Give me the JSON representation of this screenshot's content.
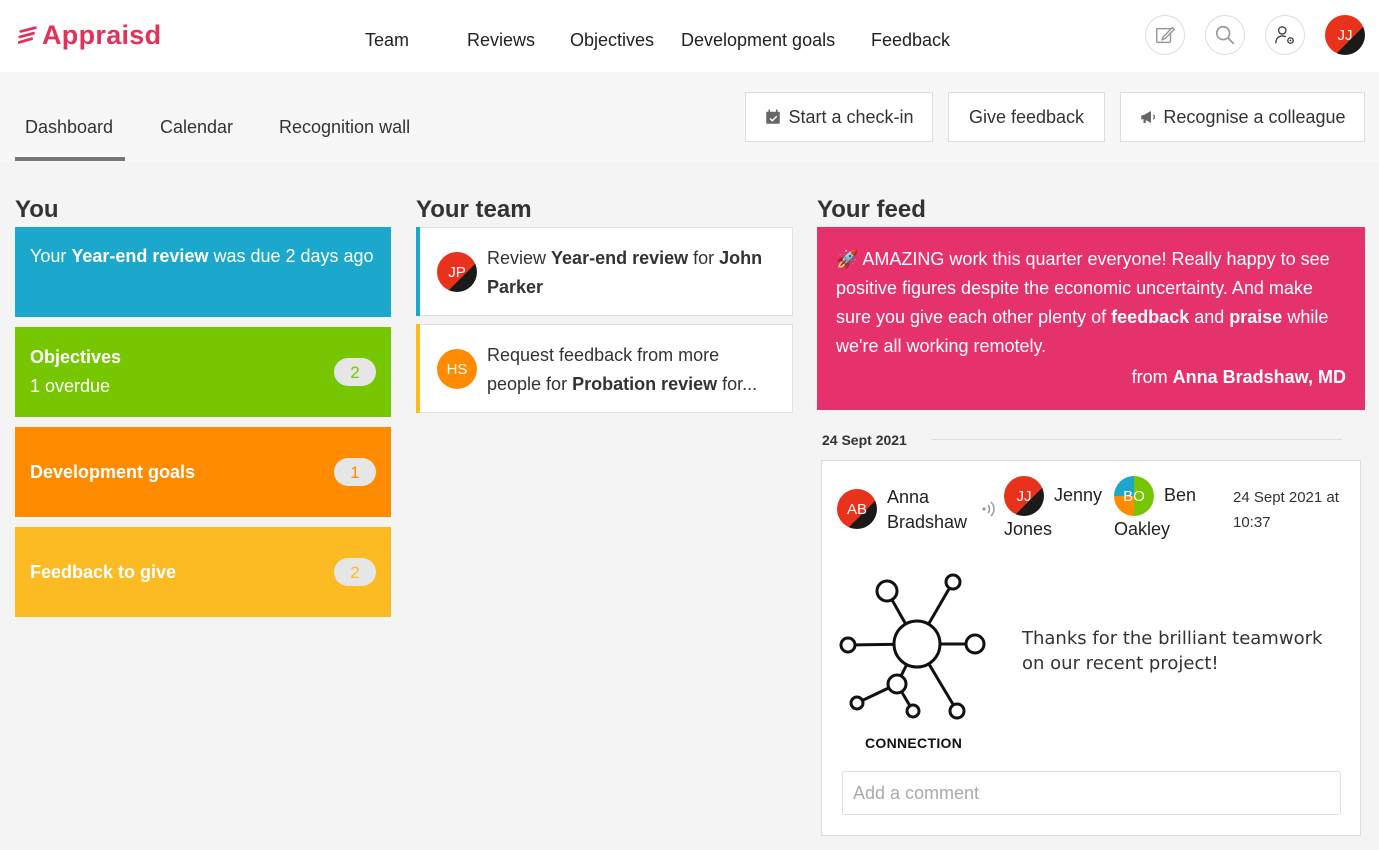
{
  "app": {
    "logo_text": "Appraisd",
    "brand_color": "#e0335b"
  },
  "nav": {
    "items": [
      "Team",
      "Reviews",
      "Objectives",
      "Development goals",
      "Feedback"
    ]
  },
  "header_icons": [
    "edit-icon",
    "search-icon",
    "user-settings-icon"
  ],
  "user": {
    "initials": "JJ"
  },
  "tabs": [
    "Dashboard",
    "Calendar",
    "Recognition wall"
  ],
  "active_tab": "Dashboard",
  "actions": {
    "checkin": "Start a check-in",
    "feedback": "Give feedback",
    "recognise": "Recognise a colleague"
  },
  "you": {
    "title": "You",
    "review": {
      "pre": "Your ",
      "bold": "Year-end review",
      "post": " was due 2 days ago",
      "color": "#1ba8cc"
    },
    "objectives": {
      "title": "Objectives",
      "sub": "1 overdue",
      "count": "2",
      "color": "#76c702"
    },
    "dev_goals": {
      "title": "Development goals",
      "count": "1",
      "color": "#ff8c00"
    },
    "feedback_to_give": {
      "title": "Feedback to give",
      "count": "2",
      "color": "#fdbb23"
    }
  },
  "team": {
    "title": "Your team",
    "card1": {
      "initials": "JP",
      "pre": "Review ",
      "bold1": "Year-end review",
      "mid": " for ",
      "bold2": "John Parker"
    },
    "card2": {
      "initials": "HS",
      "line1": "Request feedback from more",
      "pre": "people for ",
      "bold": "Probation review",
      "post": " for..."
    }
  },
  "feed": {
    "title": "Your feed",
    "announcement": {
      "emoji": "🚀",
      "pre": " AMAZING work this quarter everyone! Really happy to see positive figures despite the economic uncertainty. And make sure you give each other plenty of ",
      "bold1": "feedback",
      "mid": " and ",
      "bold2": "praise",
      "post": " while we're all working remotely.",
      "from_pre": "from ",
      "from_name": "Anna Bradshaw, MD",
      "color": "#e6326c"
    },
    "date_separator": "24 Sept 2021",
    "post": {
      "sender": {
        "initials": "AB",
        "first": "Anna",
        "last": "Bradshaw"
      },
      "recipients": [
        {
          "initials": "JJ",
          "first": "Jenny",
          "last": "Jones"
        },
        {
          "initials": "BO",
          "first": "Ben",
          "last": "Oakley"
        }
      ],
      "timestamp_line1": "24 Sept 2021 at",
      "timestamp_line2": "10:37",
      "badge_label": "CONNECTION",
      "message": "Thanks for the brilliant teamwork on our recent project!",
      "comment_placeholder": "Add a comment"
    }
  }
}
